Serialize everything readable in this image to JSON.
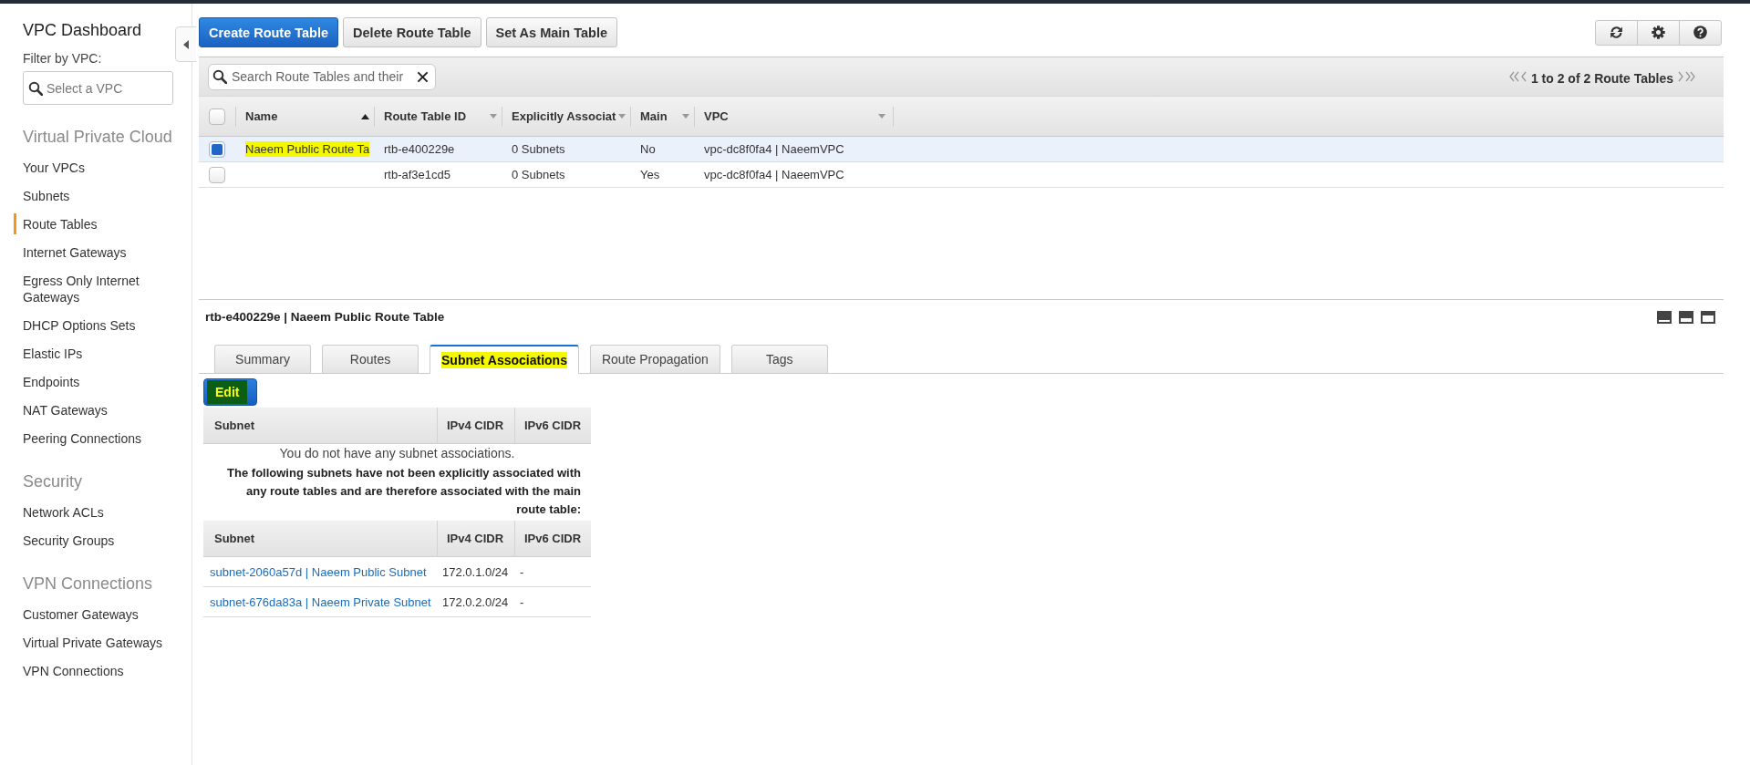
{
  "sidebar": {
    "title": "VPC Dashboard",
    "filter_label": "Filter by VPC:",
    "filter": {
      "placeholder": "Select a VPC"
    },
    "sections": [
      {
        "heading": "Virtual Private Cloud",
        "items": [
          {
            "label": "Your VPCs",
            "selected": false
          },
          {
            "label": "Subnets",
            "selected": false
          },
          {
            "label": "Route Tables",
            "selected": true
          },
          {
            "label": "Internet Gateways",
            "selected": false
          },
          {
            "label": "Egress Only Internet Gateways",
            "selected": false
          },
          {
            "label": "DHCP Options Sets",
            "selected": false
          },
          {
            "label": "Elastic IPs",
            "selected": false
          },
          {
            "label": "Endpoints",
            "selected": false
          },
          {
            "label": "NAT Gateways",
            "selected": false
          },
          {
            "label": "Peering Connections",
            "selected": false
          }
        ]
      },
      {
        "heading": "Security",
        "items": [
          {
            "label": "Network ACLs",
            "selected": false
          },
          {
            "label": "Security Groups",
            "selected": false
          }
        ]
      },
      {
        "heading": "VPN Connections",
        "items": [
          {
            "label": "Customer Gateways",
            "selected": false
          },
          {
            "label": "Virtual Private Gateways",
            "selected": false
          },
          {
            "label": "VPN Connections",
            "selected": false
          }
        ]
      }
    ]
  },
  "toolbar": {
    "buttons": [
      {
        "label": "Create Route Table",
        "kind": "primary"
      },
      {
        "label": "Delete Route Table",
        "kind": "default"
      },
      {
        "label": "Set As Main Table",
        "kind": "default"
      }
    ]
  },
  "route_tables": {
    "search": {
      "placeholder": "Search Route Tables and their"
    },
    "pagination": "1 to 2 of 2 Route Tables",
    "all_selected": false,
    "columns": [
      {
        "label": "Name",
        "sorted": true
      },
      {
        "label": "Route Table ID",
        "sorted": false
      },
      {
        "label": "Explicitly Associat",
        "sorted": false
      },
      {
        "label": "Main",
        "sorted": false
      },
      {
        "label": "VPC",
        "sorted": false
      }
    ],
    "rows": [
      {
        "selected": true,
        "name": "Naeem Public Route Ta",
        "name_highlighted": true,
        "route_table_id": "rtb-e400229e",
        "explicitly_associated": "0 Subnets",
        "main": "No",
        "vpc": "vpc-dc8f0fa4 | NaeemVPC"
      },
      {
        "selected": false,
        "route_table_id": "rtb-af3e1cd5",
        "explicitly_associated": "0 Subnets",
        "main": "Yes",
        "vpc": "vpc-dc8f0fa4 | NaeemVPC"
      }
    ]
  },
  "details": {
    "title": "rtb-e400229e | Naeem Public Route Table",
    "tabs": [
      {
        "label": "Summary",
        "selected": false,
        "highlighted": false
      },
      {
        "label": "Routes",
        "selected": false,
        "highlighted": false
      },
      {
        "label": "Subnet Associations",
        "selected": true,
        "highlighted": true
      },
      {
        "label": "Route Propagation",
        "selected": false,
        "highlighted": false
      },
      {
        "label": "Tags",
        "selected": false,
        "highlighted": false
      }
    ],
    "edit_button": {
      "label": "Edit",
      "highlighted": true
    },
    "associations": {
      "columns": [
        "Subnet",
        "IPv4 CIDR",
        "IPv6 CIDR"
      ],
      "empty_message": "You do not have any subnet associations."
    },
    "main_table_note": "The following subnets have not been explicitly associated with any route tables and are therefore associated with the main route table:",
    "implicit_associations": {
      "columns": [
        "Subnet",
        "IPv4 CIDR",
        "IPv6 CIDR"
      ],
      "rows": [
        {
          "subnet": "subnet-2060a57d | Naeem Public Subnet",
          "ipv4_cidr": "172.0.1.0/24",
          "ipv6_cidr": "-"
        },
        {
          "subnet": "subnet-676da83a | Naeem Private Subnet",
          "ipv4_cidr": "172.0.2.0/24",
          "ipv6_cidr": "-"
        }
      ]
    }
  }
}
